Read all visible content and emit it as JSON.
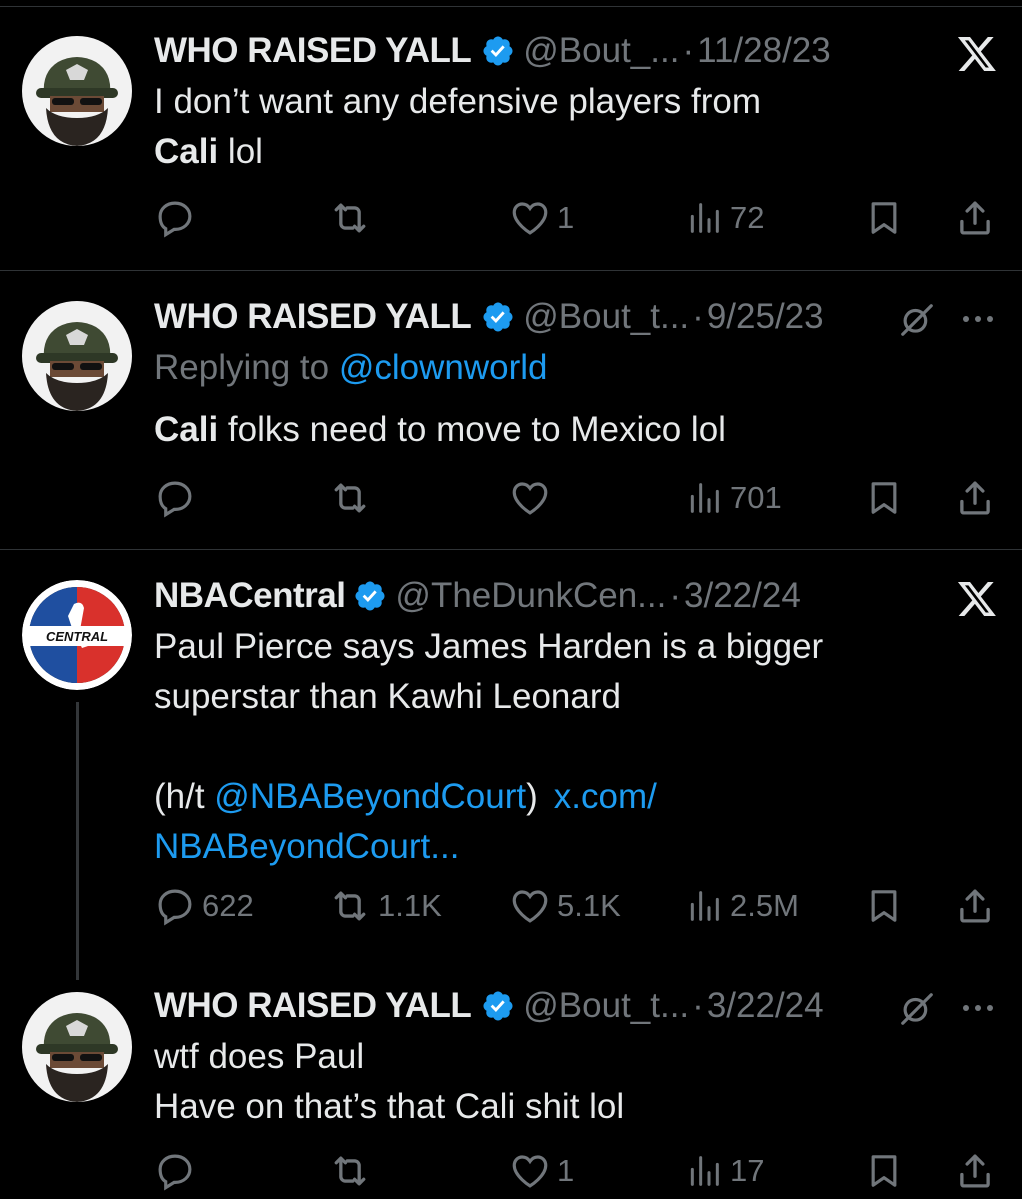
{
  "tweets": [
    {
      "name": "WHO RAISED YALL",
      "handle": "@Bout_...",
      "date": "11/28/23",
      "line1": "I don’t want any defensive players from",
      "line2_bold": "Cali",
      "line2_rest": " lol",
      "stats": {
        "replies": "",
        "retweets": "",
        "likes": "1",
        "views": "72"
      },
      "top_icon": "x-logo-icon"
    },
    {
      "name": "WHO RAISED YALL",
      "handle": "@Bout_t...",
      "date": "9/25/23",
      "replying_prefix": "Replying to ",
      "replying_handle": "@clownworld",
      "line1_bold": "Cali",
      "line1_rest": " folks need to move to Mexico lol",
      "stats": {
        "replies": "",
        "retweets": "",
        "likes": "",
        "views": "701"
      },
      "top_icon": "grok-icon"
    },
    {
      "name": "NBACentral",
      "handle": "@TheDunkCen...",
      "date": "3/22/24",
      "line1": "Paul Pierce says James Harden is a bigger",
      "line2": "superstar than Kawhi Leonard",
      "line3_prefix": "(h/t ",
      "line3_mention": "@NBABeyondCourt",
      "line3_close": ")",
      "line3_link": "x.com/",
      "line4_link": "NBABeyondCourt...",
      "avatar_text": "CENTRAL",
      "stats": {
        "replies": "622",
        "retweets": "1.1K",
        "likes": "5.1K",
        "views": "2.5M"
      },
      "top_icon": "x-logo-icon"
    },
    {
      "name": "WHO RAISED YALL",
      "handle": "@Bout_t...",
      "date": "3/22/24",
      "line1": "wtf does Paul",
      "line2": "Have on that’s that Cali shit lol",
      "stats": {
        "replies": "",
        "retweets": "",
        "likes": "1",
        "views": "17"
      },
      "top_icon": "grok-icon"
    }
  ],
  "separator": "·",
  "colors": {
    "background": "#000000",
    "text": "#e7e9ea",
    "muted": "#71767b",
    "link": "#1d9bf0",
    "verified": "#1d9bf0",
    "divider": "#2f3336"
  }
}
